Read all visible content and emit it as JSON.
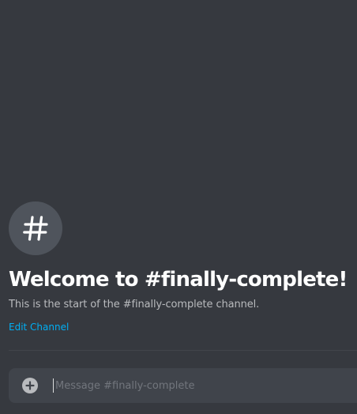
{
  "channel": {
    "icon": "hash-icon",
    "welcome_title": "Welcome to #finally-complete!",
    "welcome_subtitle": "This is the start of the #finally-complete channel.",
    "edit_label": "Edit Channel"
  },
  "composer": {
    "attach_icon": "plus-circle-icon",
    "placeholder": "Message #finally-complete",
    "value": ""
  },
  "colors": {
    "background": "#36393f",
    "icon_circle": "#4f545c",
    "title": "#ffffff",
    "subtitle": "#b9bbbe",
    "link": "#00aff4",
    "composer_bg": "#40444b",
    "placeholder": "#72767d"
  }
}
